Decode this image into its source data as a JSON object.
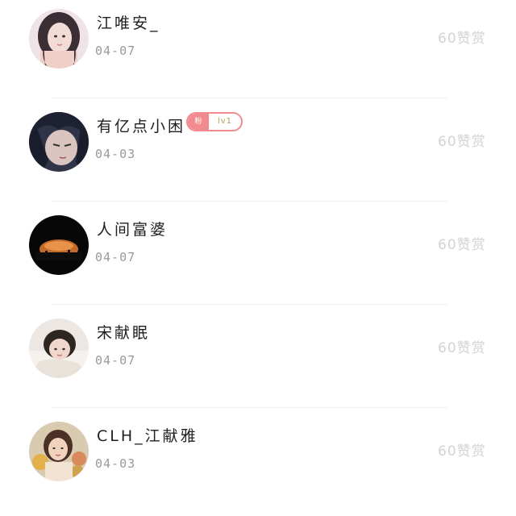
{
  "comments": [
    {
      "name": "江唯安_",
      "date": "04-07",
      "likes": "60赞赏",
      "badge": null
    },
    {
      "name": "有亿点小困",
      "date": "04-03",
      "likes": "60赞赏",
      "badge": {
        "left": "粉",
        "right": "lv1"
      }
    },
    {
      "name": "人间富婆",
      "date": "04-07",
      "likes": "60赞赏",
      "badge": null
    },
    {
      "name": "宋献眠",
      "date": "04-07",
      "likes": "60赞赏",
      "badge": null
    },
    {
      "name": "CLH_江献雅",
      "date": "04-03",
      "likes": "60赞赏",
      "badge": null
    }
  ],
  "colors": {
    "badge_accent": "#f28b8f",
    "badge_level_text": "#b8a24a",
    "likes_text": "#d2d2d2",
    "date_text": "#9a9a9a"
  },
  "icons": [
    "avatar-woman-long-hair",
    "avatar-anime-dark",
    "avatar-sunset",
    "avatar-girl-lying",
    "avatar-woman-flowers"
  ]
}
